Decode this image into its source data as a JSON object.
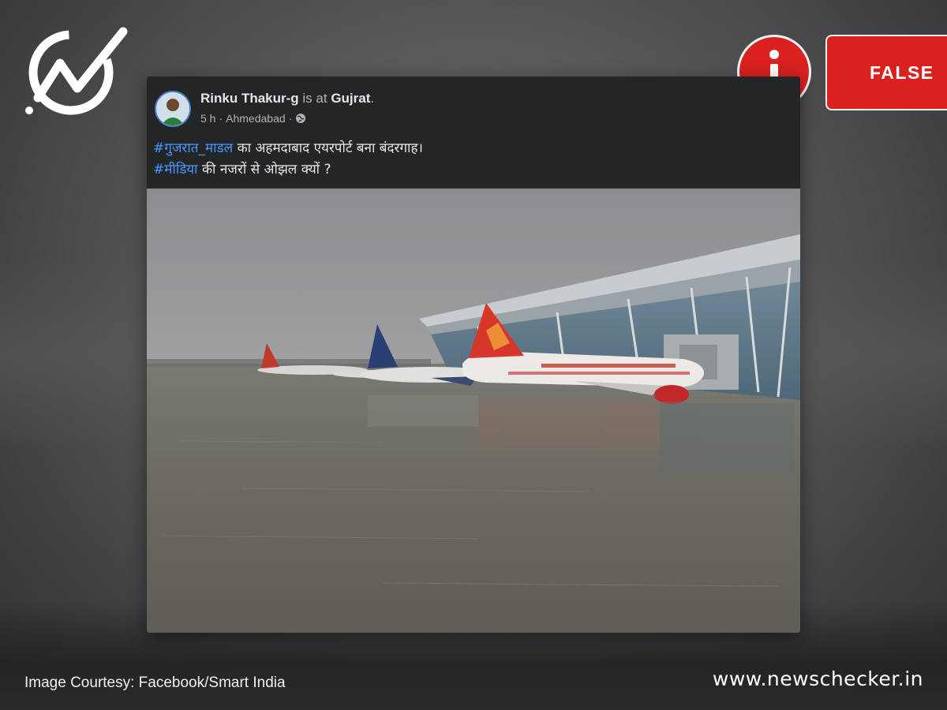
{
  "post": {
    "author": "Rinku Thakur-g",
    "connector": "is at",
    "location": "Gujrat",
    "time": "5 h",
    "place": "Ahmedabad",
    "separator": "·",
    "line1_hashtag": "#गुजरात_माडल",
    "line1_text": " का अहमदाबाद एयरपोर्ट बना बंदरगाह।",
    "line2_hashtag": "#मीडिया",
    "line2_text": " की नजरों से ओझल क्यों ?",
    "privacy_icon": "globe-icon"
  },
  "verdict": {
    "label": "FALSE",
    "icon": "info-icon"
  },
  "footer": {
    "credit": "Image Courtesy: Facebook/Smart India",
    "site": "www.newschecker.in"
  },
  "colors": {
    "accent_red": "#d9211f",
    "hashtag_blue": "#4599ff",
    "card_bg": "#242526"
  }
}
